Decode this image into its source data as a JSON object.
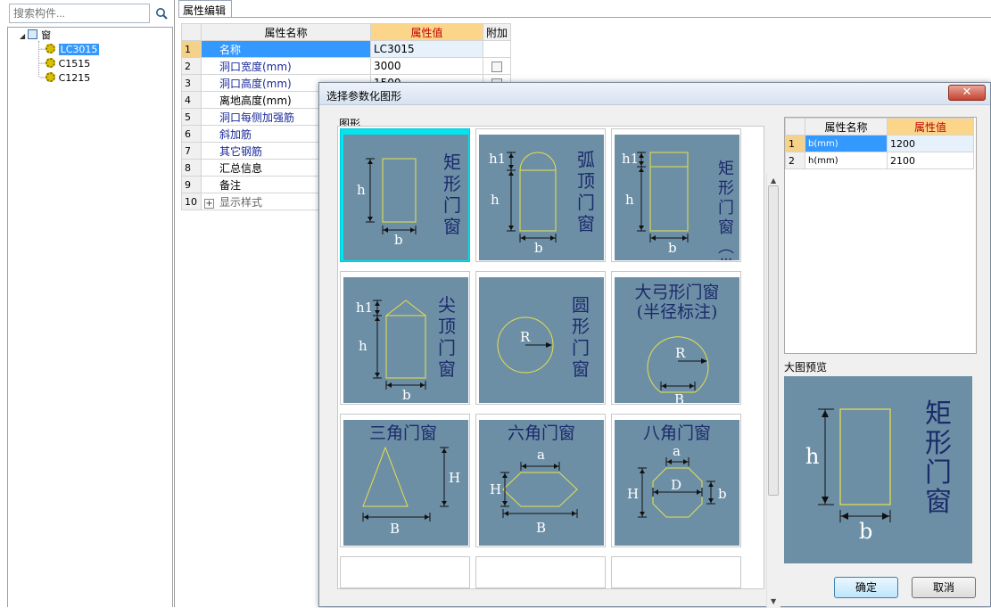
{
  "left_panel": {
    "search_placeholder": "搜索构件...",
    "tree": {
      "root": "窗",
      "children": [
        "LC3015",
        "C1515",
        "C1215"
      ],
      "selected": "LC3015"
    }
  },
  "property_editor": {
    "tab": "属性编辑",
    "headers": [
      "属性名称",
      "属性值",
      "附加"
    ],
    "rows": [
      {
        "num": "1",
        "name": "名称",
        "value": "LC3015"
      },
      {
        "num": "2",
        "name": "洞口宽度(mm)",
        "value": "3000"
      },
      {
        "num": "3",
        "name": "洞口高度(mm)",
        "value": "1500"
      },
      {
        "num": "4",
        "name": "离地高度(mm)",
        "value": ""
      },
      {
        "num": "5",
        "name": "洞口每侧加强筋",
        "value": ""
      },
      {
        "num": "6",
        "name": "斜加筋",
        "value": ""
      },
      {
        "num": "7",
        "name": "其它钢筋",
        "value": ""
      },
      {
        "num": "8",
        "name": "汇总信息",
        "value": ""
      },
      {
        "num": "9",
        "name": "备注",
        "value": ""
      },
      {
        "num": "10",
        "name": "显示样式",
        "value": ""
      }
    ]
  },
  "dialog": {
    "title": "选择参数化图形",
    "close_label": "✕",
    "group_label": "图形",
    "shapes": [
      {
        "name": "矩形门窗",
        "labels": [
          "h",
          "b"
        ]
      },
      {
        "name": "弧顶门窗",
        "labels": [
          "h1",
          "h",
          "b"
        ]
      },
      {
        "name": "矩形门窗(带亮子)",
        "labels": [
          "h1",
          "h",
          "b"
        ]
      },
      {
        "name": "尖顶门窗",
        "labels": [
          "h1",
          "h",
          "b"
        ]
      },
      {
        "name": "圆形门窗",
        "labels": [
          "R"
        ]
      },
      {
        "name": "大弓形门窗(半径标注)",
        "labels": [
          "R",
          "B"
        ]
      },
      {
        "name": "三角门窗",
        "labels": [
          "H",
          "B"
        ]
      },
      {
        "name": "六角门窗",
        "labels": [
          "a",
          "H",
          "B"
        ]
      },
      {
        "name": "八角门窗",
        "labels": [
          "a",
          "D",
          "H",
          "b"
        ]
      }
    ],
    "param_table": {
      "headers": [
        "属性名称",
        "属性值"
      ],
      "rows": [
        {
          "num": "1",
          "name": "b(mm)",
          "value": "1200"
        },
        {
          "num": "2",
          "name": "h(mm)",
          "value": "2100"
        }
      ]
    },
    "preview_label": "大图预览",
    "preview": {
      "title": "矩形门窗",
      "h": "h",
      "b": "b"
    },
    "ok": "确定",
    "cancel": "取消"
  },
  "colors": {
    "shape_bg": "#6d8fa6",
    "shape_line": "#e8e04a",
    "selection": "#00e5f0",
    "header_value": "#fbd58a"
  }
}
